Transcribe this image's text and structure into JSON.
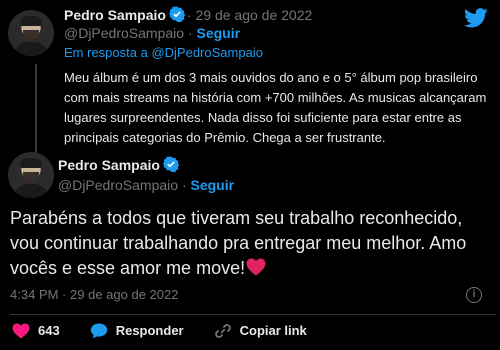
{
  "colors": {
    "background": "#000000",
    "text": "#e7e9ea",
    "muted": "#71767b",
    "link": "#1d9bf0",
    "like": "#f91880"
  },
  "icons": [
    "twitter-bird-icon",
    "verified-badge-icon",
    "heart-icon",
    "speech-bubble-icon",
    "link-icon",
    "info-icon"
  ],
  "quoted_tweet": {
    "author_name": "Pedro Sampaio",
    "separator": "·",
    "date": "29 de ago de 2022",
    "handle": "@DjPedroSampaio",
    "follow_label": "Seguir",
    "reply_prefix": "Em resposta a",
    "reply_handle": "@DjPedroSampaio",
    "text": "Meu álbum é um dos 3 mais ouvidos do ano e o 5° álbum pop brasileiro com mais streams na história com +700 milhões. As musicas alcançaram lugares surpreendentes. Nada disso foi suficiente para estar entre as principais categorias do Prêmio. Chega a ser frustrante."
  },
  "tweet": {
    "author_name": "Pedro Sampaio",
    "handle": "@DjPedroSampaio",
    "separator": "·",
    "follow_label": "Seguir",
    "text": "Parabéns a todos que tiveram seu trabalho reconhecido, vou continuar trabalhando pra entregar meu melhor. Amo vocês e esse amor me move!",
    "time": "4:34 PM",
    "date_separator": "·",
    "date": "29 de ago de 2022",
    "info_glyph": "i",
    "likes": "643",
    "reply_label": "Responder",
    "copy_link_label": "Copiar link"
  }
}
